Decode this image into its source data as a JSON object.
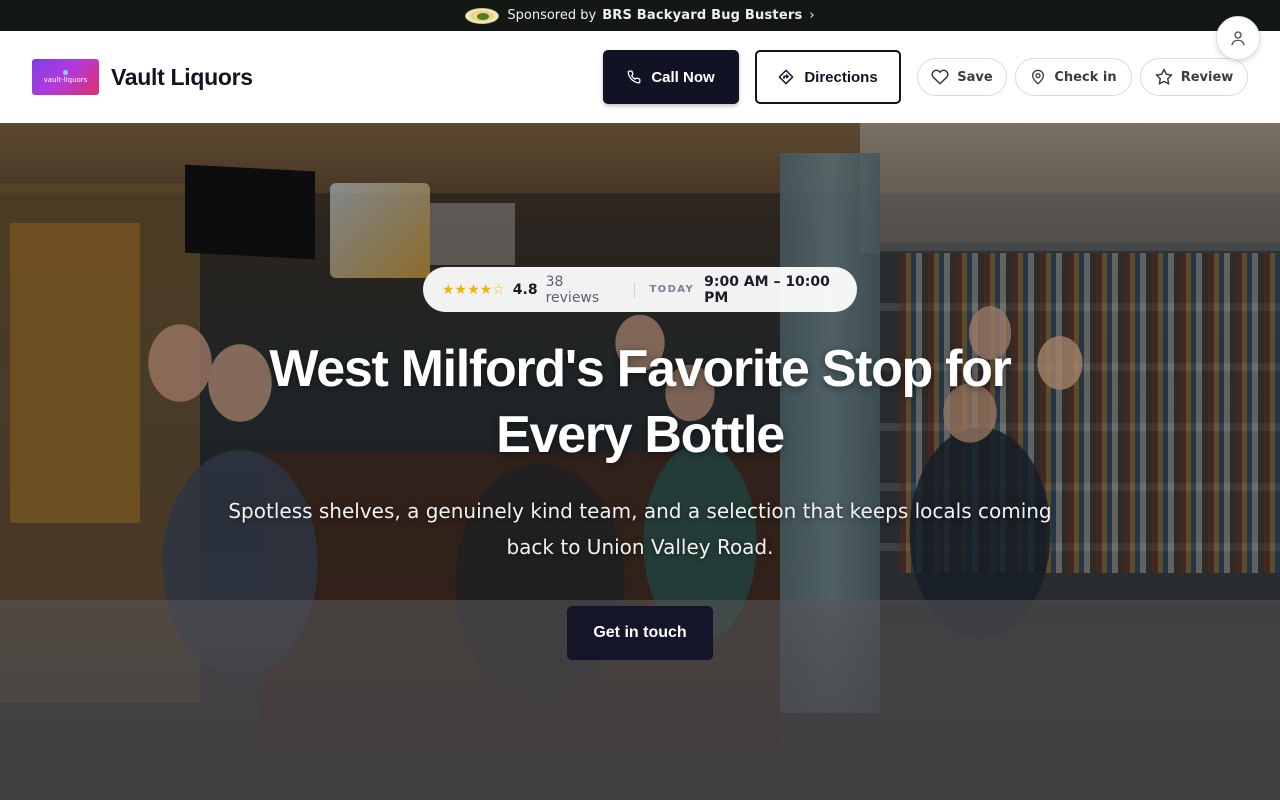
{
  "sponsor": {
    "prefix": "Sponsored by",
    "name": "BRS Backyard Bug Busters",
    "chevron": "›",
    "logo_icon": "bug-busters-logo"
  },
  "header": {
    "logo_text": "vault-liquors",
    "business_name": "Vault Liquors",
    "call_label": "Call Now",
    "directions_label": "Directions",
    "save_label": "Save",
    "checkin_label": "Check in",
    "review_label": "Review"
  },
  "hero": {
    "rating_stars": "★★★★",
    "rating_half_star": "☆",
    "rating_value": "4.8",
    "reviews": "38 reviews",
    "today_label": "TODAY",
    "hours": "9:00 AM – 10:00 PM",
    "title": "West Milford's Favorite Stop for Every Bottle",
    "subtitle": "Spotless shelves, a genuinely kind team, and a selection that keeps locals coming back to Union Valley Road.",
    "cta_label": "Get in touch"
  },
  "colors": {
    "primary": "#111325",
    "sponsor_bar": "#131815",
    "star": "#f5b301"
  }
}
